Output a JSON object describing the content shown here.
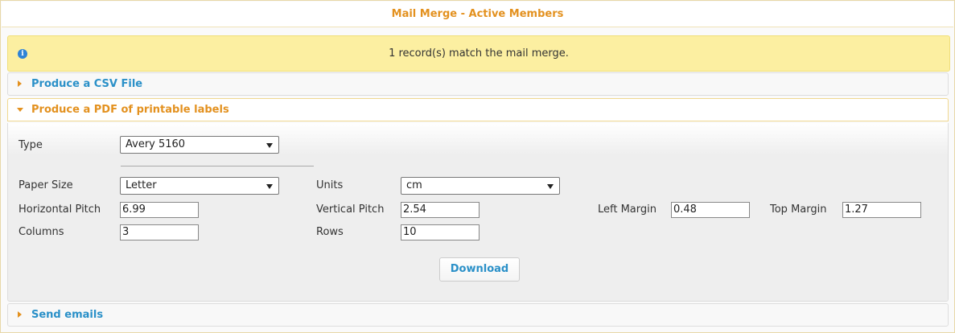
{
  "header": {
    "title": "Mail Merge - Active Members"
  },
  "info": {
    "icon": "info-icon",
    "message": "1 record(s) match the mail merge."
  },
  "sections": [
    {
      "label": "Produce a CSV File",
      "expanded": false
    },
    {
      "label": "Produce a PDF of printable labels",
      "expanded": true
    },
    {
      "label": "Send emails",
      "expanded": false
    }
  ],
  "labels_form": {
    "type_label": "Type",
    "type_value": "Avery 5160",
    "paper_size_label": "Paper Size",
    "paper_size_value": "Letter",
    "units_label": "Units",
    "units_value": "cm",
    "horizontal_pitch_label": "Horizontal Pitch",
    "horizontal_pitch_value": "6.99",
    "vertical_pitch_label": "Vertical Pitch",
    "vertical_pitch_value": "2.54",
    "left_margin_label": "Left Margin",
    "left_margin_value": "0.48",
    "top_margin_label": "Top Margin",
    "top_margin_value": "1.27",
    "columns_label": "Columns",
    "columns_value": "3",
    "rows_label": "Rows",
    "rows_value": "10",
    "download_label": "Download"
  },
  "colors": {
    "accent_orange": "#e3911f",
    "link_blue": "#2a90c8",
    "info_bg": "#fcefa1"
  }
}
